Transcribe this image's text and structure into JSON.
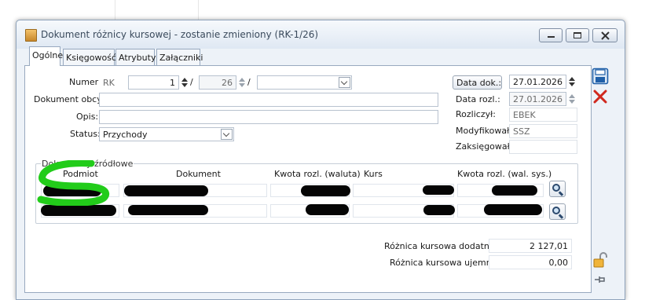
{
  "window": {
    "title": "Dokument różnicy kursowej - zostanie zmieniony  (RK-1/26)"
  },
  "tabs": [
    {
      "label": "Ogólne",
      "active": true
    },
    {
      "label": "Księgowość",
      "active": false
    },
    {
      "label": "Atrybuty",
      "active": false
    },
    {
      "label": "Załączniki",
      "active": false
    }
  ],
  "form": {
    "numer_label": "Numer:",
    "numer_prefix": "RK",
    "numer_value": "1",
    "numer_sep1": "/",
    "numer_year": "26",
    "numer_sep2": "/",
    "numer_series": "",
    "dokument_obcy_label": "Dokument obcy:",
    "dokument_obcy_value": "",
    "opis_label": "Opis:",
    "opis_value": "",
    "status_label": "Status:",
    "status_value": "Przychody"
  },
  "right": {
    "data_dok_button": "Data dok.:",
    "data_dok_value": "27.01.2026",
    "data_rozl_label": "Data rozl.:",
    "data_rozl_value": "27.01.2026",
    "rozliczyl_label": "Rozliczył:",
    "rozliczyl_value": "EBEK",
    "modyfikowal_label": "Modyfikował:",
    "modyfikowal_value": "SSZ",
    "zaksiegowal_label": "Zaksięgował:",
    "zaksiegowal_value": ""
  },
  "sources": {
    "group_title": "Dokumenty źródłowe",
    "columns": [
      "Podmiot",
      "Dokument",
      "Kwota rozl. (waluta)",
      "Kurs",
      "Kwota rozl. (wal. sys.)"
    ]
  },
  "totals": {
    "dodatnia_label": "Różnica kursowa dodatnia:",
    "dodatnia_value": "2 127,01",
    "ujemna_label": "Różnica kursowa ujemna:",
    "ujemna_value": "0,00"
  },
  "icons": [
    "document-icon",
    "minimize-icon",
    "restore-icon",
    "close-icon",
    "save-icon",
    "cancel-icon",
    "search-icon",
    "unlock-icon",
    "pin-icon"
  ],
  "colors": {
    "accent": "#1f5fa8",
    "cancel_red": "#d0281e",
    "annotation_green": "#22cc1a"
  }
}
